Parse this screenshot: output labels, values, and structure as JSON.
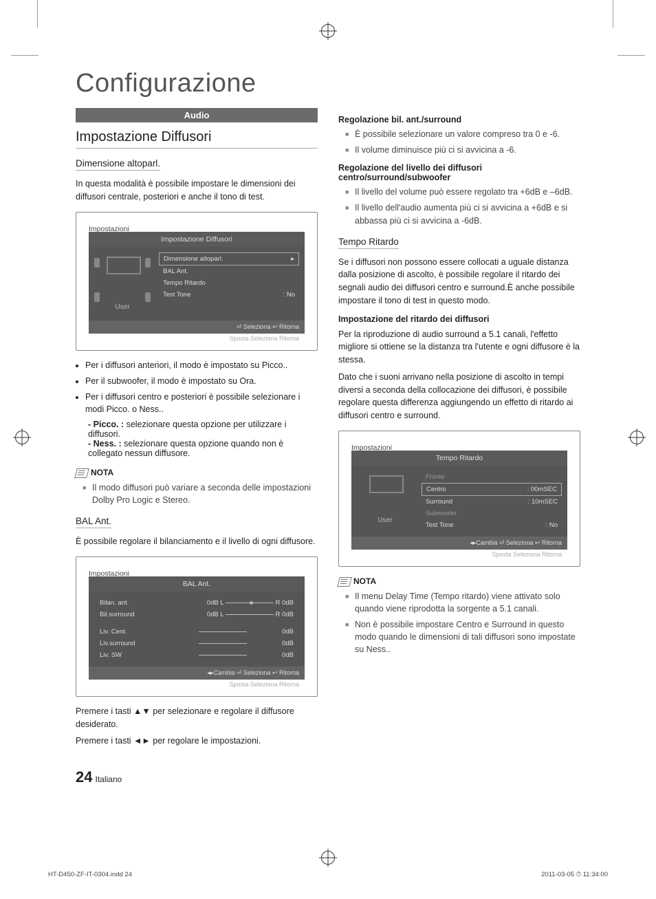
{
  "title": "Configurazione",
  "section_bar": "Audio",
  "left": {
    "h2": "Impostazione Diffusori",
    "dim_head": "Dimensione altoparl.",
    "dim_intro": "In questa modalità è possibile impostare le dimensioni dei diffusori centrale, posteriori e anche il tono di test.",
    "bullets": [
      "Per i diffusori anteriori, il modo è impostato su Picco..",
      "Per il subwoofer, il modo è impostato su Ora.",
      "Per i diffusori centro e posteriori è possibile selezionare i modi Picco. o Ness.."
    ],
    "picco_label": "- Picco. :",
    "picco_text": "selezionare questa opzione per utilizzare i diffusori.",
    "ness_label": "- Ness. :",
    "ness_text": "selezionare questa opzione quando non è collegato nessun diffusore.",
    "nota_label": "NOTA",
    "nota_item": "Il modo diffusori può variare a seconda delle impostazioni Dolby Pro Logic e Stereo.",
    "bal_head": "BAL Ant.",
    "bal_text": "È possibile regolare il bilanciamento e il livello di ogni diffusore.",
    "press1": "Premere i tasti ▲▼ per selezionare e regolare il diffusore desiderato.",
    "press2": "Premere i tasti ◄► per regolare le impostazioni.",
    "osd1": {
      "crumb": "Impostazioni",
      "title": "Impostazione Diffusori",
      "user": "User",
      "rows": [
        {
          "label": "Dimensione altoparl.",
          "val": "▸",
          "sel": true
        },
        {
          "label": "BAL Ant.",
          "val": ""
        },
        {
          "label": "Tempo Ritardo",
          "val": ""
        },
        {
          "label": "Test Tone",
          "val": ":   No"
        }
      ],
      "footer": "⏎ Seleziona   ↩ Ritorna",
      "footer2": "Sposta   Seleziona   Ritorna"
    },
    "osd2": {
      "crumb": "Impostazioni",
      "title": "BAL Ant.",
      "rows": [
        {
          "label": "Bilan. ant.",
          "mid": "0dB L",
          "end": "R 0dB",
          "slider": "half"
        },
        {
          "label": "Bil.surround",
          "mid": "0dB L",
          "end": "R 0dB",
          "slider": "plain"
        }
      ],
      "rows2": [
        {
          "label": "Liv. Cent.",
          "val": "0dB"
        },
        {
          "label": "Liv.surround",
          "val": "0dB"
        },
        {
          "label": "Liv. SW",
          "val": "0dB"
        }
      ],
      "footer": "◂▸Cambia ⏎ Seleziona  ↩ Ritorna",
      "footer2": "Sposta   Seleziona   Ritorna"
    }
  },
  "right": {
    "reg1_head": "Regolazione bil. ant./surround",
    "reg1_items": [
      "È possibile selezionare un valore compreso tra 0 e -6.",
      "Il volume diminuisce più ci si avvicina a -6."
    ],
    "reg2_head": "Regolazione del livello dei diffusori centro/surround/subwoofer",
    "reg2_items": [
      "Il livello del volume può essere regolato tra +6dB e –6dB.",
      "Il livello dell'audio aumenta più ci si avvicina a +6dB e si abbassa più ci si avvicina a -6dB."
    ],
    "tempo_head": "Tempo Ritardo",
    "tempo_text": "Se i diffusori non possono essere collocati a uguale distanza dalla posizione di ascolto, è possibile regolare il ritardo dei segnali audio dei diffusori centro e surround.È anche possibile impostare il tono di test in questo modo.",
    "imp_head": "Impostazione del ritardo dei diffusori",
    "imp_p1": "Per la riproduzione di audio surround a 5.1 canali, l'effetto migliore si ottiene se la distanza tra l'utente e ogni diffusore è la stessa.",
    "imp_p2": "Dato che i suoni arrivano nella posizione di ascolto in tempi diversi a seconda della collocazione dei diffusori, è possibile regolare questa differenza aggiungendo un effetto di ritardo ai diffusori centro e surround.",
    "osd3": {
      "crumb": "Impostazioni",
      "title": "Tempo Ritardo",
      "user": "User",
      "rows": [
        {
          "label": "Fronte",
          "val": "",
          "dim": true
        },
        {
          "label": "Centro",
          "val": ":   00mSEC",
          "sel": true
        },
        {
          "label": "Surround",
          "val": ":   10mSEC"
        },
        {
          "label": "Subwoofer",
          "val": "",
          "dim": true
        },
        {
          "label": "Test Tone",
          "val": ":   No"
        }
      ],
      "footer": "◂▸Cambia ⏎ Seleziona  ↩ Ritorna",
      "footer2": "Sposta   Seleziona   Ritorna"
    },
    "nota_label": "NOTA",
    "nota_items": [
      "Il menu Delay Time (Tempo ritardo) viene attivato solo quando viene riprodotta la sorgente a 5.1 canali.",
      "Non è possibile impostare Centro e Surround in questo modo quando le dimensioni di tali diffusori sono impostate su Ness.."
    ]
  },
  "page_number": "24",
  "page_lang": "Italiano",
  "footer_file": "HT-D450-ZF-IT-0304.indd   24",
  "footer_date": "2011-03-05   ⏱ 11:34:00"
}
